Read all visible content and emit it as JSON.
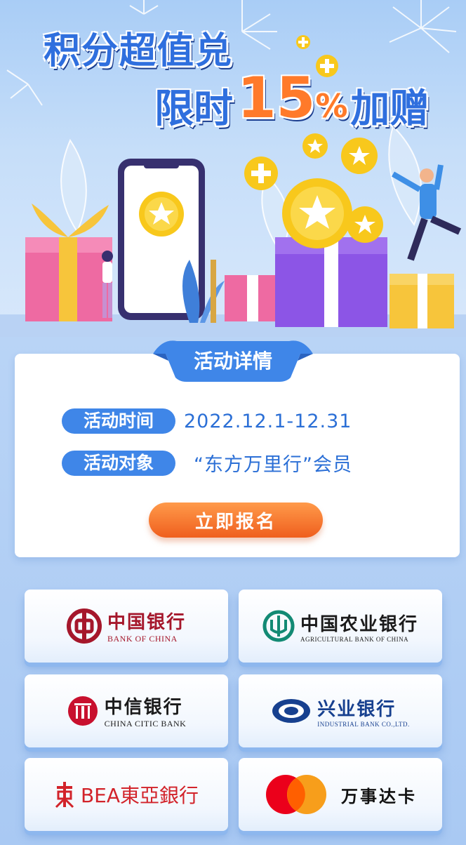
{
  "banner": {
    "title_line1": "积分超值兑",
    "title_line2_prefix": "限时",
    "title_line2_number": "15",
    "title_line2_percent": "%",
    "title_line2_suffix": "加赠"
  },
  "details": {
    "tab_label": "活动详情",
    "time_label": "活动时间",
    "time_value": "2022.12.1-12.31",
    "audience_label": "活动对象",
    "audience_value": "“东方万里行”会员",
    "signup_label": "立即报名"
  },
  "banks": [
    {
      "name_cn": "中国银行",
      "name_en": "BANK OF CHINA"
    },
    {
      "name_cn": "中国农业银行",
      "name_en": "AGRICULTURAL BANK OF CHINA"
    },
    {
      "name_cn": "中信银行",
      "name_en": "CHINA CITIC BANK"
    },
    {
      "name_cn": "兴业银行",
      "name_en": "INDUSTRIAL BANK CO.,LTD."
    },
    {
      "name_cn": "BEA東亞銀行"
    },
    {
      "name_cn": "万事达卡"
    }
  ],
  "colors": {
    "brand_blue": "#3f86e8",
    "accent_orange": "#ef5f1e",
    "boc_red": "#a5172b",
    "abc_green": "#138a74",
    "cib_blue": "#17408f",
    "mastercard_red": "#eb001b",
    "mastercard_orange": "#f79e1b"
  }
}
